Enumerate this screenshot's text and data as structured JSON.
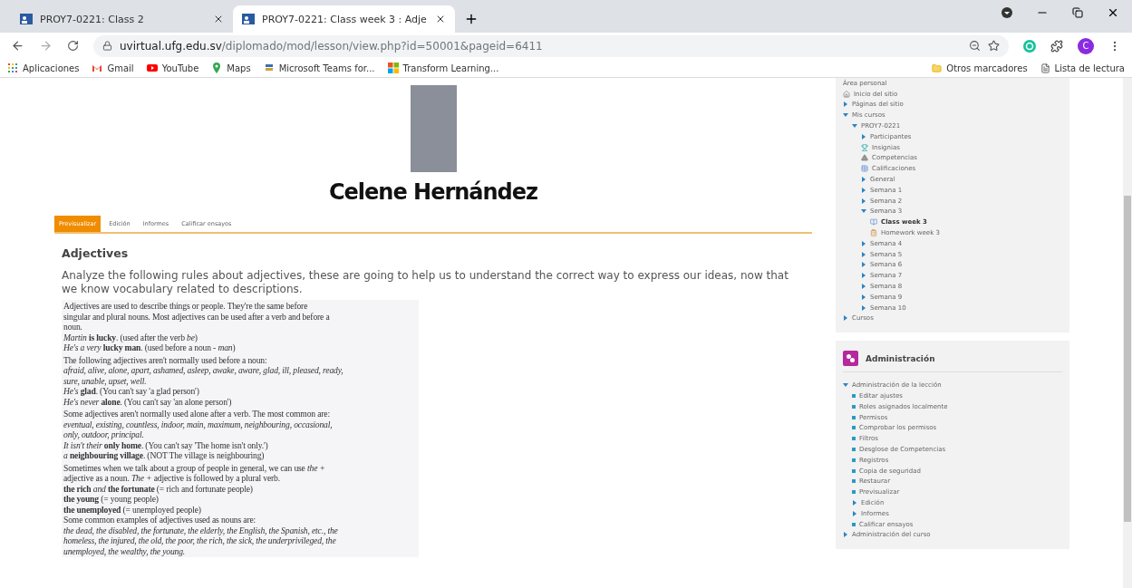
{
  "browser": {
    "tabs": [
      {
        "title": "PROY7-0221: Class 2",
        "selected": false
      },
      {
        "title": "PROY7-0221: Class week 3 : Adje",
        "selected": true
      }
    ],
    "url": {
      "host": "uvirtual.ufg.edu.sv",
      "path": "/diplomado/mod/lesson/view.php?id=50001&pageid=6411"
    },
    "profile_initial": "C",
    "bookmarks": [
      {
        "label": "Aplicaciones",
        "kind": "apps"
      },
      {
        "label": "Gmail",
        "kind": "gmail"
      },
      {
        "label": "YouTube",
        "kind": "youtube"
      },
      {
        "label": "Maps",
        "kind": "maps"
      },
      {
        "label": "Microsoft Teams for...",
        "kind": "teams"
      },
      {
        "label": "Transform Learning...",
        "kind": "windows"
      }
    ],
    "other_bookmarks": "Otros marcadores",
    "reading_list": "Lista de lectura"
  },
  "profile": {
    "name": "Celene Hernández"
  },
  "lesson_tabs": [
    {
      "label": "Previsualizar",
      "selected": true
    },
    {
      "label": "Edición",
      "selected": false
    },
    {
      "label": "Informes",
      "selected": false
    },
    {
      "label": "Calificar ensayos",
      "selected": false
    }
  ],
  "lesson": {
    "title": "Adjectives",
    "intro": "Analyze the following rules about adjectives, these are going to help us to understand the correct way to express our ideas, now that we know vocabulary related to descriptions.",
    "document": [
      [
        {
          "text": "Adjectives are used to describe things or people. They're the same before",
          "kind": "prose"
        },
        {
          "text": "singular and plural nouns. Most adjectives can be used after a verb and before a",
          "kind": "prose"
        },
        {
          "text": "noun.",
          "kind": "prose"
        },
        {
          "text": "*Martin* **is lucky**. (used after the verb *be*)",
          "kind": "prose"
        },
        {
          "text": "*He's a very* **lucky man**. (used before a noun - *man*)",
          "kind": "prose"
        }
      ],
      [
        {
          "text": "The following adjectives aren't normally used before a noun:",
          "kind": "prose"
        },
        {
          "text": "afraid, alive, alone, apart, ashamed, asleep, awake, aware, glad, ill, pleased, ready,",
          "kind": "wordlist"
        },
        {
          "text": "sure, unable, upset, well.",
          "kind": "wordlist"
        },
        {
          "text": "*He's* **glad**. (You can't say 'a glad person')",
          "kind": "prose"
        },
        {
          "text": "*He's never* **alone**. (You can't say 'an alone person')",
          "kind": "prose"
        }
      ],
      [
        {
          "text": "Some adjectives aren't normally used alone after a verb. The most common are:",
          "kind": "prose"
        },
        {
          "text": "eventual, existing, countless, indoor, main, maximum, neighbouring, occasional,",
          "kind": "wordlist"
        },
        {
          "text": "only, outdoor, principal.",
          "kind": "wordlist"
        },
        {
          "text": "*It isn't their* **only home**. (You can't say 'The home isn't only.')",
          "kind": "prose"
        },
        {
          "text": "*a* **neighbouring village**. (NOT The village is neighbouring)",
          "kind": "prose"
        }
      ],
      [
        {
          "text": "Sometimes when we talk about a group of people in general, we can use *the +*",
          "kind": "prose"
        },
        {
          "text": "adjective as a noun. *The +* adjective is followed by a plural verb.",
          "kind": "prose"
        },
        {
          "text": "**the rich** *and* **the fortunate** (= rich and fortunate people)",
          "kind": "prose"
        },
        {
          "text": "**the young** (= young people)",
          "kind": "prose"
        },
        {
          "text": "**the unemployed** (= unemployed people)",
          "kind": "prose"
        },
        {
          "text": "Some common examples of adjectives used as nouns are:",
          "kind": "prose"
        },
        {
          "text": "the dead, the disabled, the fortunate, the elderly, the English, the Spanish, etc., the",
          "kind": "wordlist"
        },
        {
          "text": "homeless, the injured, the old, the poor, the rich, the sick, the underprivileged, the",
          "kind": "wordlist"
        },
        {
          "text": "unemployed, the wealthy, the young.",
          "kind": "wordlist"
        }
      ]
    ]
  },
  "navigation": {
    "items": [
      {
        "label": "Área personal",
        "kind": "none"
      },
      {
        "label": "Inicio del sitio",
        "kind": "house"
      },
      {
        "label": "Páginas del sitio",
        "kind": "branch",
        "expanded": false
      },
      {
        "label": "Mis cursos",
        "kind": "branch",
        "expanded": true,
        "children": [
          {
            "label": "PROY7-0221",
            "kind": "branch",
            "expanded": true,
            "children": [
              {
                "label": "Participantes",
                "kind": "branch",
                "expanded": false
              },
              {
                "label": "Insignias",
                "kind": "trophy"
              },
              {
                "label": "Competencias",
                "kind": "pyramid"
              },
              {
                "label": "Calificaciones",
                "kind": "table"
              },
              {
                "label": "General",
                "kind": "branch",
                "expanded": false
              },
              {
                "label": "Semana 1",
                "kind": "branch",
                "expanded": false
              },
              {
                "label": "Semana 2",
                "kind": "branch",
                "expanded": false
              },
              {
                "label": "Semana 3",
                "kind": "branch",
                "expanded": true,
                "children": [
                  {
                    "label": "Class week 3",
                    "kind": "lesson",
                    "current": true
                  },
                  {
                    "label": "Homework week 3",
                    "kind": "assignment",
                    "current": false
                  }
                ]
              },
              {
                "label": "Semana 4",
                "kind": "branch",
                "expanded": false
              },
              {
                "label": "Semana 5",
                "kind": "branch",
                "expanded": false
              },
              {
                "label": "Semana 6",
                "kind": "branch",
                "expanded": false
              },
              {
                "label": "Semana 7",
                "kind": "branch",
                "expanded": false
              },
              {
                "label": "Semana 8",
                "kind": "branch",
                "expanded": false
              },
              {
                "label": "Semana 9",
                "kind": "branch",
                "expanded": false
              },
              {
                "label": "Semana 10",
                "kind": "branch",
                "expanded": false
              }
            ]
          }
        ]
      },
      {
        "label": "Cursos",
        "kind": "branch",
        "expanded": false
      }
    ]
  },
  "administration": {
    "title": "Administración",
    "items": [
      {
        "label": "Administración de la lección",
        "kind": "branch",
        "expanded": true,
        "children": [
          {
            "label": "Editar ajustes",
            "kind": "bullet"
          },
          {
            "label": "Roles asignados localmente",
            "kind": "bullet"
          },
          {
            "label": "Permisos",
            "kind": "bullet"
          },
          {
            "label": "Comprobar los permisos",
            "kind": "bullet"
          },
          {
            "label": "Filtros",
            "kind": "bullet"
          },
          {
            "label": "Desglose de Competencias",
            "kind": "bullet"
          },
          {
            "label": "Registros",
            "kind": "bullet"
          },
          {
            "label": "Copia de seguridad",
            "kind": "bullet"
          },
          {
            "label": "Restaurar",
            "kind": "bullet"
          },
          {
            "label": "Previsualizar",
            "kind": "bullet"
          },
          {
            "label": "Edición",
            "kind": "branch",
            "expanded": false
          },
          {
            "label": "Informes",
            "kind": "branch",
            "expanded": false
          },
          {
            "label": "Calificar ensayos",
            "kind": "bullet"
          }
        ]
      },
      {
        "label": "Administración del curso",
        "kind": "branch",
        "expanded": false
      }
    ]
  }
}
